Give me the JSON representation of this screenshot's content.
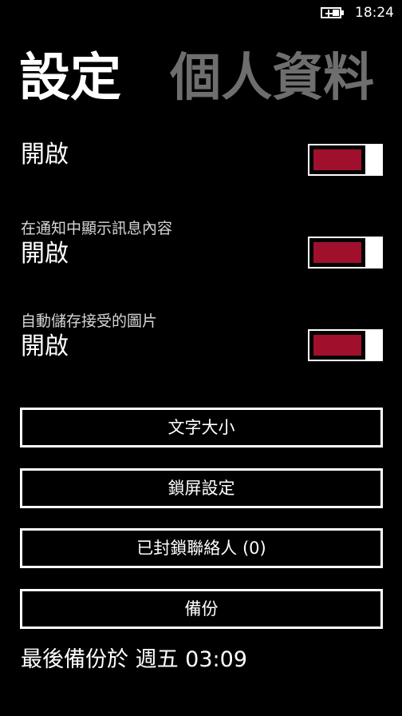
{
  "status_bar": {
    "time": "18:24",
    "battery_icon": "battery-charging-icon"
  },
  "pivot": {
    "items": [
      {
        "label": "設定",
        "active": true
      },
      {
        "label": "個人資料",
        "active": false
      }
    ]
  },
  "toggles": [
    {
      "caption": "",
      "state": "開啟",
      "on": true
    },
    {
      "caption": "在通知中顯示訊息內容",
      "state": "開啟",
      "on": true
    },
    {
      "caption": "自動儲存接受的圖片",
      "state": "開啟",
      "on": true
    }
  ],
  "buttons": {
    "font_size": "文字大小",
    "lock_screen": "鎖屏設定",
    "blocked_contacts": "已封鎖聯絡人 (0)",
    "backup": "備份"
  },
  "last_backup": "最後備份於 週五 03:09",
  "colors": {
    "background": "#000000",
    "accent": "#a0102d",
    "foreground": "#ffffff",
    "inactive": "#6e6e6e"
  }
}
